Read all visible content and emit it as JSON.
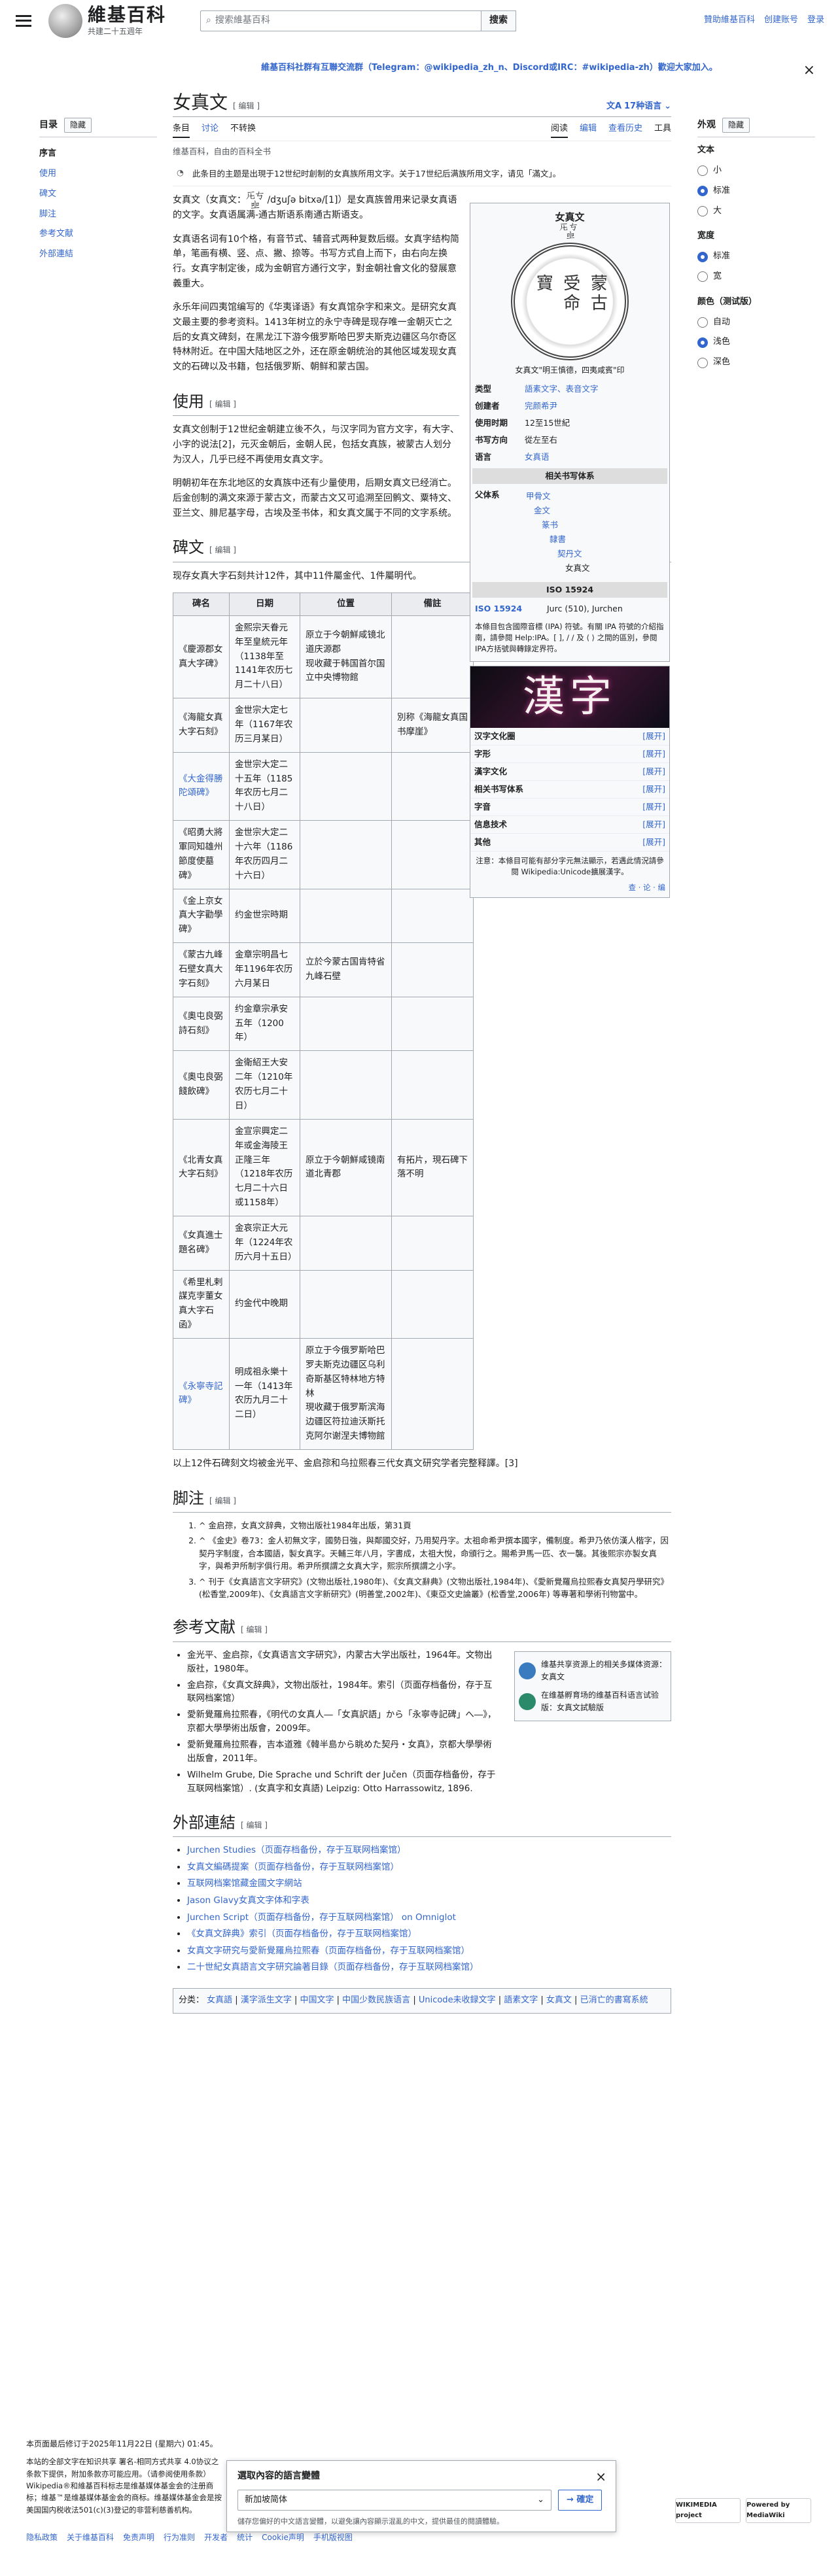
{
  "header": {
    "wordmark": "維基百科",
    "tagline": "共建二十五週年",
    "search_placeholder": "搜索維基百科",
    "search_button": "搜索",
    "links": [
      "贊助維基百科",
      "创建账号",
      "登录"
    ]
  },
  "sitenotice": {
    "text": "維基百科社群有互聯交流群（Telegram：@wikipedia_zh_n、Discord或IRC：#wikipedia-zh）歡迎大家加入。",
    "close": "×"
  },
  "toc": {
    "title": "目录",
    "hide": "隐藏",
    "items": [
      "序言",
      "使用",
      "碑文",
      "脚注",
      "参考文献",
      "外部連結"
    ]
  },
  "appearance": {
    "title": "外观",
    "hide": "隐藏",
    "text_label": "文本",
    "text_opts": [
      "小",
      "标准",
      "大"
    ],
    "width_label": "宽度",
    "width_opts": [
      "标准",
      "宽"
    ],
    "color_label": "颜色（测试版）",
    "color_opts": [
      "自动",
      "浅色",
      "深色"
    ]
  },
  "article": {
    "title": "女真文",
    "edit": "[ 编辑 ]",
    "lang_btn": "17种语言",
    "tabs_left": [
      "条目",
      "讨论",
      "不转换"
    ],
    "tabs_right": [
      "阅读",
      "编辑",
      "查看历史",
      "工具"
    ],
    "from": "维基百科，自由的百科全书",
    "hatnote": "此条目的主题是出現于12世纪时創制的女真族所用文字。关于17世纪后满族所用文字，请见「滿文」。",
    "p1": "女真文（女真文：𘬯𘮅𘯐 /dʒuʃə bitxə/[1]）是女真族曾用来记录女真语的文字。女真语属满-通古斯语系南通古斯语支。",
    "p2": "女真语名词有10个格，有音节式、辅音式两种复数后缀。女真字结构简单，笔画有横、竖、点、撇、捺等。书写方式自上而下，由右向左换行。女真字制定後，成为金朝官方通行文字，對金朝社會文化的發展意義重大。",
    "p3": "永乐年间四夷馆编写的《华夷译语》有女真馆杂字和来文。是研究女真文最主要的参考资料。1413年树立的永宁寺碑是现存唯一金朝灭亡之后的女真文碑刻，在黑龙江下游今俄罗斯哈巴罗夫斯克边疆区乌尔奇区特林附近。在中国大陆地区之外，还在原金朝统治的其他区域发现女真文的石碑以及书籍，包括俄罗斯、朝鲜和蒙古国。",
    "h_use": "使用",
    "p4": "女真文创制于12世纪金朝建立後不久，与汉字同为官方文字，有大字、小字的说法[2]，元灭金朝后，金朝人民，包括女真族，被蒙古人划分为汉人，几乎已经不再使用女真文字。",
    "p5": "明朝初年在东北地区的女真族中还有少量使用，后期女真文已经消亡。后金创制的满文來源于蒙古文，而蒙古文又可追溯至回鹘文、粟特文、亚兰文、腓尼基字母，古埃及圣书体，和女真文属于不同的文字系统。",
    "h_stele": "碑文",
    "p6": "现存女真大字石刻共计12件，其中11件屬金代、1件屬明代。",
    "table": {
      "headers": [
        "碑名",
        "日期",
        "位置",
        "備註"
      ],
      "rows": [
        [
          "《慶源郡女真大字碑》",
          "金熙宗天眷元年至皇統元年（1138年至1141年农历七月二十八日）",
          "原立于今朝鮮咸镜北道庆源郡\n现收藏于韩国首尔国立中央博物館",
          ""
        ],
        [
          "《海龍女真大字石刻》",
          "金世宗大定七年（1167年农历三月某日）",
          "",
          "別称《海龍女真国书摩崖》"
        ],
        [
          "《大金得勝陀頌碑》",
          "金世宗大定二十五年（1185年农历七月二十八日）",
          "",
          ""
        ],
        [
          "《昭勇大將軍同知雄州節度使墓碑》",
          "金世宗大定二十六年（1186年农历四月二十六日）",
          "",
          ""
        ],
        [
          "《金上京女真大字勸學碑》",
          "约金世宗時期",
          "",
          ""
        ],
        [
          "《蒙古九峰石壁女真大字石刻》",
          "金章宗明昌七年1196年农历六月某日",
          "立於今蒙古国肯特省九峰石壁",
          ""
        ],
        [
          "《奧屯良弼詩石刻》",
          "约金章宗承安五年（1200年）",
          "",
          ""
        ],
        [
          "《奧屯良弼餞飲碑》",
          "金衛紹王大安二年（1210年农历七月二十日）",
          "",
          ""
        ],
        [
          "《北青女真大字石刻》",
          "金宣宗興定二年或金海陵王正隆三年（1218年农历七月二十六日或1158年）",
          "原立于今朝鮮咸镜南道北青郡",
          "有拓片，現石碑下落不明"
        ],
        [
          "《女真進士題名碑》",
          "金哀宗正大元年（1224年农历六月十五日）",
          "",
          ""
        ],
        [
          "《希里札剌謀克孛董女真大字石函》",
          "约金代中晚期",
          "",
          ""
        ],
        [
          "《永寧寺記碑》",
          "明成祖永樂十一年（1413年农历九月二十二日）",
          "原立于今俄罗斯哈巴罗夫斯克边疆区乌利奇斯基区特林地方特林\n現收藏于俄罗斯滨海边疆区符拉迪沃斯托克阿尔谢涅夫博物館",
          ""
        ]
      ]
    },
    "p7": "以上12件石碑刻文均被金光平、金启孮和乌拉熙春三代女真文研究学者完整释譯。[3]",
    "h_notes": "脚注",
    "notes": [
      "^ 金启孮，女真文辞典，文物出版社1984年出版，第31頁",
      "^ 《金史》卷73：金人初無文字，國勢日強，與鄰國交好，乃用契丹字。太祖命希尹撰本國字，備制度。希尹乃依仿漢人楷字，因契丹字制度，合本國語，製女真字。天輔三年八月，字書成，太祖大悅，命頒行之。賜希尹馬一匹、衣一襲。其後熙宗亦製女真字，與希尹所制字俱行用。希尹所撰謂之女真大字，熙宗所撰謂之小字。",
      "^ 刊于《女真語言文字研究》(文物出版社,1980年)、《女真文辭典》(文物出版社,1984年)、《愛新覺羅烏拉熙春女真契丹學研究》(松香堂,2009年)、《女真語言文字新研究》(明善堂,2002年)、《東亞文史論叢》(松香堂,2006年) 等專著和學術刊物當中。"
    ],
    "h_bib": "参考文献",
    "bib": [
      "金光平、金启孮，《女真语言文字研究》，内蒙古大学出版社，1964年。文物出版社，1980年。",
      "金启孮，《女真文辞典》，文物出版社，1984年。索引（页面存档备份，存于互联网档案馆）",
      "愛新覺羅烏拉熙春，《明代の女真人―「女真訳語」から「永寧寺記碑」へ―》，京都大學學術出版會，2009年。",
      "愛新覺羅烏拉熙春，吉本道雅《韓半島から眺めた契丹・女真》，京都大學學術出版會，2011年。",
      "Wilhelm Grube, Die Sprache und Schrift der Jučen（页面存档备份，存于互联网档案馆）. (女真字和女真語) Leipzig: Otto Harrassowitz, 1896."
    ],
    "sister": [
      "维基共享资源上的相关多媒体资源：女真文",
      "在维基孵育场的维基百科语言试验版：女真文試驗版"
    ],
    "h_ext": "外部連結",
    "ext": [
      "Jurchen Studies（页面存档备份，存于互联网档案馆）",
      "女真文編碼提案（页面存档备份，存于互联网档案馆）",
      "互联网档案馆藏金國文字網站",
      "Jason Glavy女真文字体和字表",
      "Jurchen Script（页面存档备份，存于互联网档案馆） on Omniglot",
      "《女真文辞典》索引（页面存档备份，存于互联网档案馆）",
      "女真文字研究与愛新覺羅烏拉熙春（页面存档备份，存于互联网档案馆）",
      "二十世紀女真語言文字研究論著目錄（页面存档备份，存于互联网档案馆）"
    ],
    "cats_label": "分类：",
    "cats": [
      "女真語",
      "漢字派生文字",
      "中国文字",
      "中国少数民族语言",
      "Unicode未收録文字",
      "語素文字",
      "女真文",
      "已消亡的書寫系統"
    ]
  },
  "infobox": {
    "title": "女真文",
    "subtitle": "𘬯𘮅𘯐",
    "seal_text": "蒙古受命寶",
    "caption": "女真文\"明王慎德，四夷咸賓\"印",
    "rows": [
      [
        "类型",
        "語素文字、表音文字"
      ],
      [
        "创建者",
        "完颜希尹"
      ],
      [
        "使用时期",
        "12至15世紀"
      ],
      [
        "书写方向",
        "從左至右"
      ],
      [
        "语言",
        "女真语"
      ]
    ],
    "rel_head": "相关书写体系",
    "parent_label": "父体系",
    "tree": [
      "甲骨文",
      "金文",
      "篆书",
      "隸書",
      "契丹文",
      "女真文"
    ],
    "iso_head": "ISO 15924",
    "iso": [
      "ISO 15924",
      "Jurc (510), Jurchen"
    ],
    "ipa_note": "本條目包含國際音標 (IPA) 符號。有關 IPA 符號的介紹指南，請參閱 Help:IPA。[ ], / / 及 ⟨ ⟩ 之間的區別，參閱IPA方括號與轉錄定界符。"
  },
  "chip": {
    "glyph": "漢字",
    "rows": [
      [
        "汉字文化圈",
        "[展开]"
      ],
      [
        "字形",
        "[展开]"
      ],
      [
        "漢字文化",
        "[展开]"
      ],
      [
        "相关书写体系",
        "[展开]"
      ],
      [
        "字音",
        "[展开]"
      ],
      [
        "信息技术",
        "[展开]"
      ],
      [
        "其他",
        "[展开]"
      ]
    ],
    "note": "注意：本條目可能有部分字元無法顯示，若遇此情況請參閱 Wikipedia:Unicode擴展漢字。",
    "vte": "查 · 论 · 编"
  },
  "footer": {
    "updated": "本页面最后修订于2025年11月22日 (星期六) 01:45。",
    "license": "本站的全部文字在知识共享 署名-相同方式共享 4.0协议之条款下提供，附加条款亦可能应用。（请参阅使用条款）Wikipedia®和維基百科标志是维基媒体基金会的注册商标；维基™是维基媒体基金会的商标。维基媒体基金会是按美国国内税收法501(c)(3)登记的非营利慈善机构。",
    "links": [
      "隐私政策",
      "关于维基百科",
      "免责声明",
      "行为准则",
      "开发者",
      "统计",
      "Cookie声明",
      "手机版视图"
    ],
    "badge1": "WIKIMEDIA project",
    "badge2": "Powered by MediaWiki"
  },
  "dialog": {
    "title": "選取內容的語言變體",
    "close": "×",
    "selected": "新加坡简体",
    "confirm": "→ 確定",
    "note": "儲存您偏好的中文語言變體，以避免讓內容顯示混亂的中文，提供最佳的閱讀體驗。"
  }
}
